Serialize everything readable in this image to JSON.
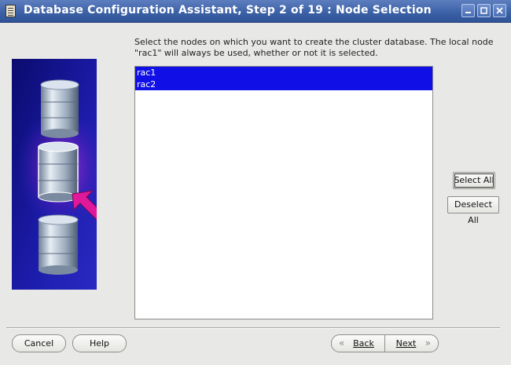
{
  "window": {
    "title": "Database Configuration Assistant, Step 2 of 19 : Node Selection",
    "controls": {
      "minimize_icon": "minimize-icon",
      "maximize_icon": "maximize-icon",
      "close_icon": "close-icon"
    }
  },
  "main": {
    "instructions": "Select the nodes on which you want to create the cluster database. The local node \"rac1\" will always be used, whether or not it is selected.",
    "nodes": [
      {
        "name": "rac1",
        "selected": true
      },
      {
        "name": "rac2",
        "selected": true
      }
    ],
    "select_all_label": "Select All",
    "deselect_all_label": "Deselect All"
  },
  "footer": {
    "cancel_label": "Cancel",
    "help_label": "Help",
    "back_label": "Back",
    "next_label": "Next"
  },
  "colors": {
    "titlebar": "#3a5fa5",
    "selection": "#1010e6",
    "arrow": "#e0189a",
    "banner": "#1a1a9a"
  }
}
